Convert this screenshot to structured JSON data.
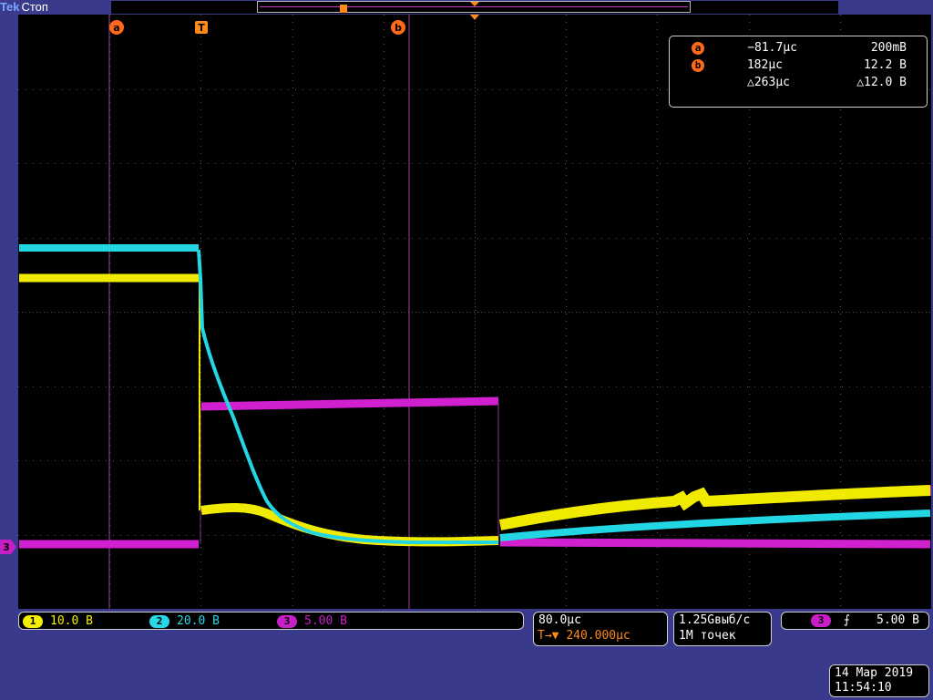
{
  "header": {
    "brand": "Tek",
    "state": "Стоп"
  },
  "cursors": {
    "a": {
      "marker": "a",
      "time": "−81.7μс",
      "value": "200mВ"
    },
    "b": {
      "marker": "b",
      "time": "182μс",
      "value": "12.2 В"
    },
    "delta": {
      "time": "△263μс",
      "value": "△12.0 В"
    }
  },
  "trigger_marker": "T",
  "ground_marker": "3",
  "channels": [
    {
      "badge": "1",
      "scale": "10.0 В",
      "color": "#f5f000"
    },
    {
      "badge": "2",
      "scale": "20.0 В",
      "color": "#27d8e6"
    },
    {
      "badge": "3",
      "scale": "5.00 В",
      "color": "#c81ec8"
    }
  ],
  "timebase": {
    "scale": "80.0μс",
    "trigger_icon": "T→▼",
    "delay": "240.000μс"
  },
  "acquisition": {
    "rate": "1.25Gвыб/с",
    "points": "1M точек"
  },
  "trigger": {
    "source": "3",
    "slope_icon": "rising-edge-icon",
    "slope_glyph": "⨍",
    "level": "5.00 В"
  },
  "datetime": {
    "date": "14 Мар 2019",
    "time": "11:54:10"
  },
  "colors": {
    "ch1": "#f5f000",
    "ch2": "#27d8e6",
    "ch3": "#c81ec8",
    "cursor": "#ff6a1a",
    "background": "#3a3a8c"
  }
}
